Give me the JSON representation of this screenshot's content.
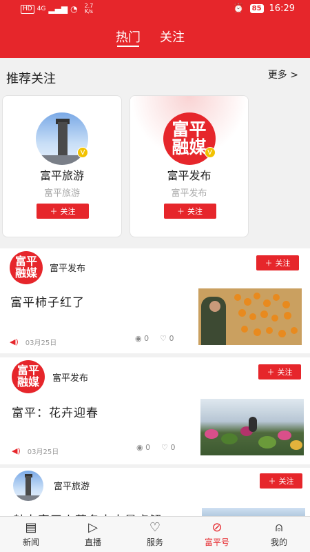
{
  "status_bar": {
    "network_badge": "HD",
    "signal": "4G",
    "speed_value": "2.7",
    "speed_unit": "K/s",
    "battery": "85",
    "time": "16:29"
  },
  "header": {
    "tabs": [
      {
        "label": "热门",
        "active": true
      },
      {
        "label": "关注",
        "active": false
      }
    ]
  },
  "recommend": {
    "title": "推荐关注",
    "more_label": "更多 >",
    "cards": [
      {
        "name": "富平旅游",
        "subtitle": "富平旅游",
        "follow_label": "关注",
        "avatar": "tower-photo"
      },
      {
        "name": "富平发布",
        "subtitle": "富平发布",
        "follow_label": "关注",
        "avatar": "fuping-media-logo",
        "logo_text": [
          "富平",
          "融媒"
        ]
      }
    ]
  },
  "posts": [
    {
      "author": "富平发布",
      "follow_label": "关注",
      "title": "富平柿子红了",
      "date": "03月25日",
      "views": "0",
      "likes": "0",
      "logo_text": [
        "富平",
        "融媒"
      ]
    },
    {
      "author": "富平发布",
      "follow_label": "关注",
      "title": "富平：花卉迎春",
      "date": "03月25日",
      "views": "0",
      "likes": "0",
      "logo_text": [
        "富平",
        "融媒"
      ]
    },
    {
      "author": "富平旅游",
      "follow_label": "关注",
      "title": "魅力富平丨著名十大景点解"
    }
  ],
  "bottom_nav": [
    {
      "label": "新闻",
      "icon": "newspaper-icon",
      "active": false
    },
    {
      "label": "直播",
      "icon": "play-icon",
      "active": false
    },
    {
      "label": "服务",
      "icon": "heart-hand-icon",
      "active": false
    },
    {
      "label": "富平号",
      "icon": "compass-icon",
      "active": true
    },
    {
      "label": "我的",
      "icon": "user-icon",
      "active": false
    }
  ],
  "colors": {
    "brand_red": "#e6262b",
    "badge_gold": "#f2c200"
  }
}
